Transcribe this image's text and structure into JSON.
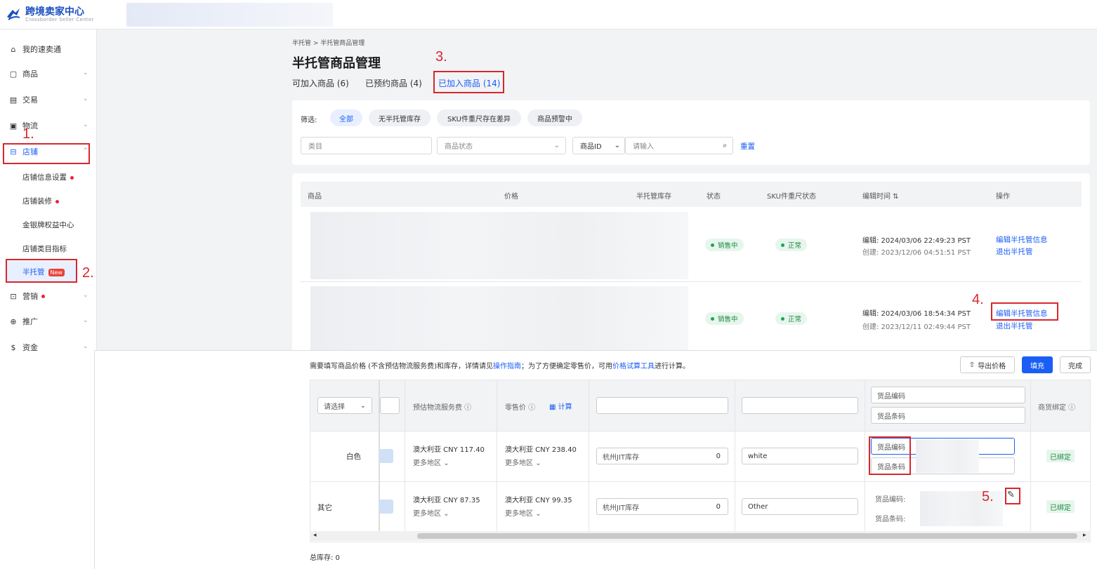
{
  "header": {
    "app_title": "跨境卖家中心",
    "app_subtitle": "Crossborder Seller Center"
  },
  "sidebar": {
    "items": [
      {
        "label": "我的速卖通",
        "icon": "home-icon"
      },
      {
        "label": "商品",
        "icon": "product-icon"
      },
      {
        "label": "交易",
        "icon": "order-icon"
      },
      {
        "label": "物流",
        "icon": "truck-icon"
      },
      {
        "label": "店铺",
        "icon": "store-icon"
      },
      {
        "label": "营销",
        "icon": "coupon-icon"
      },
      {
        "label": "推广",
        "icon": "globe-icon"
      },
      {
        "label": "资金",
        "icon": "money-icon"
      }
    ],
    "store_sub": [
      "店铺信息设置",
      "店铺装修",
      "金银牌权益中心",
      "店铺类目指标",
      "半托管"
    ],
    "new_tag": "New"
  },
  "steps": [
    "1.",
    "2.",
    "3.",
    "4.",
    "5."
  ],
  "main": {
    "breadcrumb": "半托管 > 半托管商品管理",
    "title": "半托管商品管理",
    "tabs": [
      "可加入商品 (6)",
      "已预约商品 (4)",
      "已加入商品 (14)"
    ],
    "filter_label": "筛选:",
    "chips": [
      "全部",
      "无半托管库存",
      "SKU件重尺存在差异",
      "商品预警中"
    ],
    "category_placeholder": "类目",
    "status_placeholder": "商品状态",
    "id_select": "商品ID",
    "search_placeholder": "请输入",
    "reset": "重置",
    "columns": [
      "商品",
      "价格",
      "半托管库存",
      "状态",
      "SKU件重尺状态",
      "编辑时间 ⇅",
      "操作"
    ],
    "rows": [
      {
        "status": "销售中",
        "sku_status": "正常",
        "edited": "编辑: 2024/03/06 22:49:23 PST",
        "created": "创建: 2023/12/06 04:51:51 PST",
        "action1": "编辑半托管信息",
        "action2": "退出半托管"
      },
      {
        "status": "销售中",
        "sku_status": "正常",
        "edited": "编辑: 2024/03/06 18:54:34 PST",
        "created": "创建: 2023/12/11 02:49:44 PST",
        "action1": "编辑半托管信息",
        "action2": "退出半托管"
      }
    ]
  },
  "editor": {
    "notice_a": "需要填写商品价格 (不含预估物流服务费)和库存，详情请见",
    "notice_link1": "操作指南",
    "notice_b": "；为了方便确定零售价，可用",
    "notice_link2": "价格试算工具",
    "notice_c": "进行计算。",
    "export_button": "导出价格",
    "fill_button": "填充",
    "done_button": "完成",
    "select_placeholder": "请选择",
    "col_logistics": "预估物流服务费 ⓘ",
    "col_retail": "零售价 ⓘ",
    "calc_link": "计算",
    "code_label": "货品编码",
    "barcode_label": "货品条码",
    "code_label_colon": "货品编码:",
    "barcode_label_colon": "货品条码:",
    "col_binding": "商货绑定 ⓘ",
    "more_regions": "更多地区",
    "stock_label": "杭州JIT库存",
    "rows": [
      {
        "variant": "白色",
        "logistics": "澳大利亚 CNY 117.40",
        "retail": "澳大利亚 CNY 238.40",
        "stock": "0",
        "sku": "white",
        "binding": "已绑定"
      },
      {
        "variant": "其它",
        "logistics": "澳大利亚 CNY 87.35",
        "retail": "澳大利亚 CNY 99.35",
        "stock": "0",
        "sku": "Other",
        "binding": "已绑定"
      }
    ],
    "total_stock": "总库存: 0"
  }
}
